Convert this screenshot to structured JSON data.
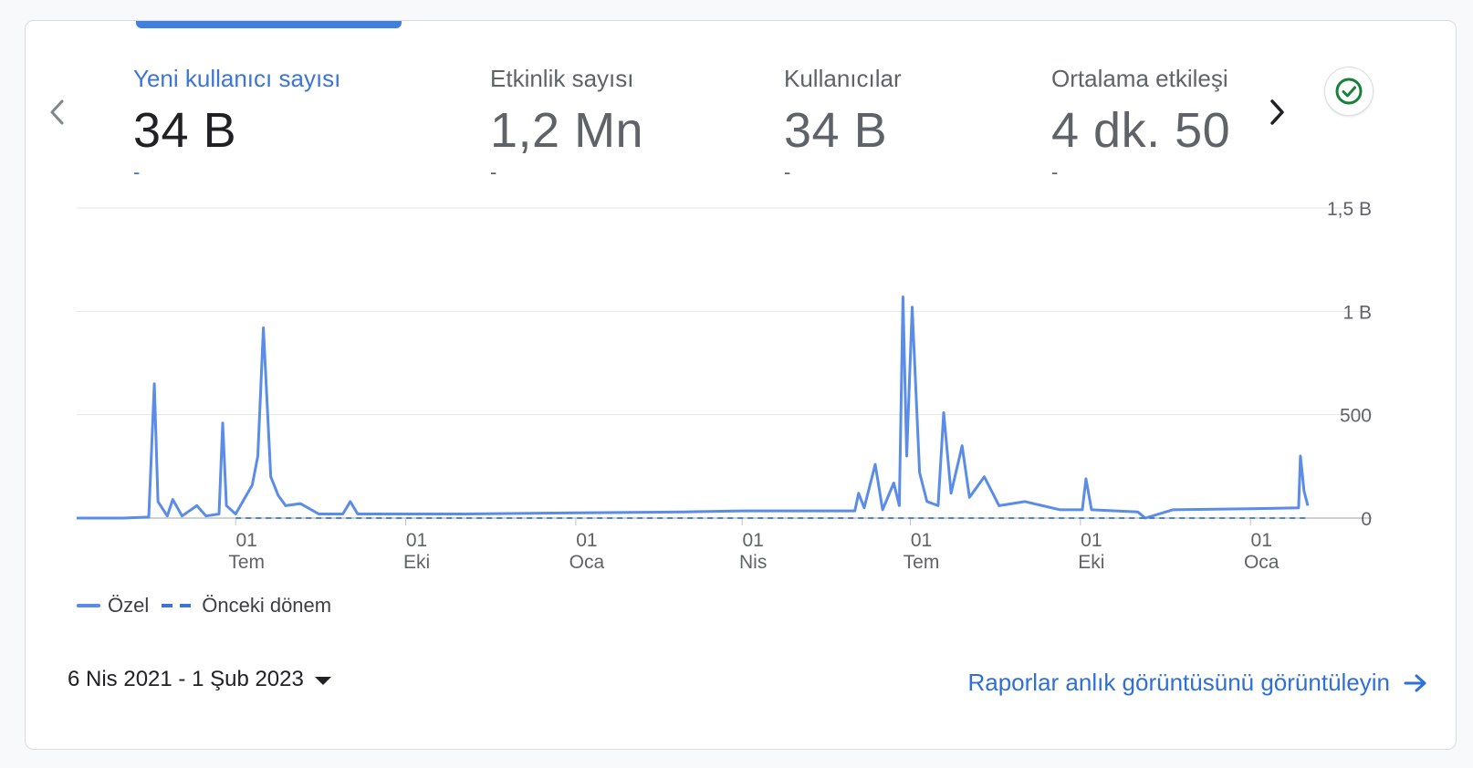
{
  "metrics": [
    {
      "label": "Yeni kullanıcı sayısı",
      "value": "34 B",
      "delta": "-"
    },
    {
      "label": "Etkinlik sayısı",
      "value": "1,2 Mn",
      "delta": "-"
    },
    {
      "label": "Kullanıcılar",
      "value": "34 B",
      "delta": "-"
    },
    {
      "label": "Ortalama etkileşi",
      "value": "4 dk. 50",
      "delta": "-"
    }
  ],
  "icons": {
    "prev": "chevron-left-icon",
    "next": "chevron-right-icon",
    "check": "check-circle-icon",
    "caret": "caret-down-icon",
    "arrow": "arrow-right-icon"
  },
  "colors": {
    "accent": "#3d74d9",
    "series": "#5a8ce8",
    "check": "#188038",
    "link": "#2f6fd8"
  },
  "chart_data": {
    "type": "line",
    "y_ticks": [
      "1,5 B",
      "1 B",
      "500",
      "0"
    ],
    "y_tick_values": [
      1500,
      1000,
      500,
      0
    ],
    "ylim": [
      0,
      1500
    ],
    "x_range": [
      "2021-04-06",
      "2023-02-01"
    ],
    "x_ticks": [
      {
        "date": "2021-07-01",
        "day": "01",
        "month": "Tem"
      },
      {
        "date": "2021-10-01",
        "day": "01",
        "month": "Eki"
      },
      {
        "date": "2022-01-01",
        "day": "01",
        "month": "Oca"
      },
      {
        "date": "2022-04-01",
        "day": "01",
        "month": "Nis"
      },
      {
        "date": "2022-07-01",
        "day": "01",
        "month": "Tem"
      },
      {
        "date": "2022-10-01",
        "day": "01",
        "month": "Eki"
      },
      {
        "date": "2023-01-01",
        "day": "01",
        "month": "Oca"
      }
    ],
    "grid": true,
    "legend": "bottom-left",
    "series": [
      {
        "name": "Özel",
        "style": "solid",
        "points": [
          [
            "2021-04-06",
            0
          ],
          [
            "2021-05-01",
            0
          ],
          [
            "2021-05-15",
            5
          ],
          [
            "2021-05-18",
            650
          ],
          [
            "2021-05-20",
            80
          ],
          [
            "2021-05-25",
            10
          ],
          [
            "2021-05-28",
            90
          ],
          [
            "2021-06-02",
            10
          ],
          [
            "2021-06-10",
            60
          ],
          [
            "2021-06-15",
            10
          ],
          [
            "2021-06-22",
            20
          ],
          [
            "2021-06-24",
            460
          ],
          [
            "2021-06-26",
            60
          ],
          [
            "2021-07-01",
            20
          ],
          [
            "2021-07-10",
            160
          ],
          [
            "2021-07-13",
            300
          ],
          [
            "2021-07-16",
            920
          ],
          [
            "2021-07-20",
            200
          ],
          [
            "2021-07-24",
            110
          ],
          [
            "2021-07-28",
            60
          ],
          [
            "2021-08-05",
            70
          ],
          [
            "2021-08-15",
            20
          ],
          [
            "2021-08-28",
            20
          ],
          [
            "2021-09-01",
            80
          ],
          [
            "2021-09-05",
            20
          ],
          [
            "2021-10-01",
            20
          ],
          [
            "2021-11-01",
            20
          ],
          [
            "2022-01-01",
            25
          ],
          [
            "2022-03-01",
            30
          ],
          [
            "2022-04-01",
            35
          ],
          [
            "2022-06-01",
            35
          ],
          [
            "2022-06-03",
            120
          ],
          [
            "2022-06-06",
            50
          ],
          [
            "2022-06-12",
            260
          ],
          [
            "2022-06-16",
            40
          ],
          [
            "2022-06-22",
            170
          ],
          [
            "2022-06-25",
            60
          ],
          [
            "2022-06-27",
            1070
          ],
          [
            "2022-06-29",
            300
          ],
          [
            "2022-07-02",
            1020
          ],
          [
            "2022-07-06",
            220
          ],
          [
            "2022-07-10",
            80
          ],
          [
            "2022-07-16",
            60
          ],
          [
            "2022-07-19",
            510
          ],
          [
            "2022-07-23",
            120
          ],
          [
            "2022-07-29",
            350
          ],
          [
            "2022-08-02",
            100
          ],
          [
            "2022-08-10",
            200
          ],
          [
            "2022-08-18",
            60
          ],
          [
            "2022-09-01",
            80
          ],
          [
            "2022-09-20",
            40
          ],
          [
            "2022-10-02",
            40
          ],
          [
            "2022-10-04",
            190
          ],
          [
            "2022-10-07",
            40
          ],
          [
            "2022-11-01",
            30
          ],
          [
            "2022-11-05",
            0
          ],
          [
            "2022-11-20",
            40
          ],
          [
            "2023-01-01",
            45
          ],
          [
            "2023-01-27",
            50
          ],
          [
            "2023-01-28",
            300
          ],
          [
            "2023-01-30",
            130
          ],
          [
            "2023-02-01",
            60
          ]
        ]
      },
      {
        "name": "Önceki dönem",
        "style": "dashed",
        "points": [
          [
            "2021-07-01",
            0
          ],
          [
            "2023-02-01",
            0
          ]
        ]
      }
    ]
  },
  "date_range": "6 Nis 2021 - 1 Şub 2023",
  "report_link": "Raporlar anlık görüntüsünü görüntüleyin"
}
